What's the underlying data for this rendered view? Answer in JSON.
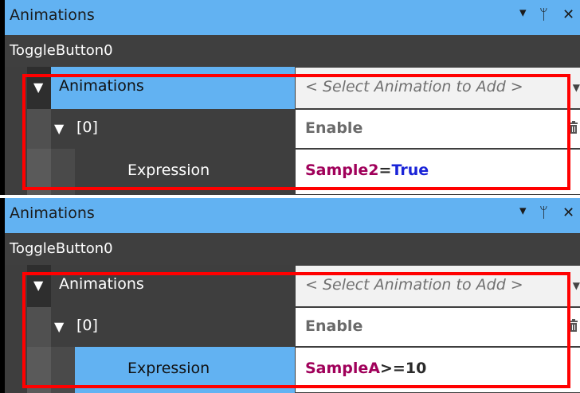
{
  "panels": [
    {
      "title": "Animations",
      "controls": {
        "dropdown": "▾",
        "pin": "ᛘ",
        "close": "✕"
      },
      "object_name": "ToggleButton0",
      "rows": {
        "animations_label": "Animations",
        "select_placeholder": "< Select Animation to Add >",
        "index_label": "[0]",
        "animation_type": "Enable",
        "expression_label": "Expression",
        "expression": {
          "part1": "Sample2",
          "part2": "=",
          "part3": "True"
        }
      }
    },
    {
      "title": "Animations",
      "controls": {
        "dropdown": "▾",
        "pin": "ᛘ",
        "close": "✕"
      },
      "object_name": "ToggleButton0",
      "rows": {
        "animations_label": "Animations",
        "select_placeholder": "< Select Animation to Add >",
        "index_label": "[0]",
        "animation_type": "Enable",
        "expression_label": "Expression",
        "expression": {
          "part1": "SampleA",
          "part2": ">=",
          "part3": "10"
        }
      }
    }
  ],
  "colors": {
    "title_bar": "#62b2f2",
    "highlight": "#62b2f2",
    "panel_bg": "#3e3e3e",
    "callout": "#ff0000",
    "variable": "#a0005a",
    "boolean": "#1a24d8"
  }
}
